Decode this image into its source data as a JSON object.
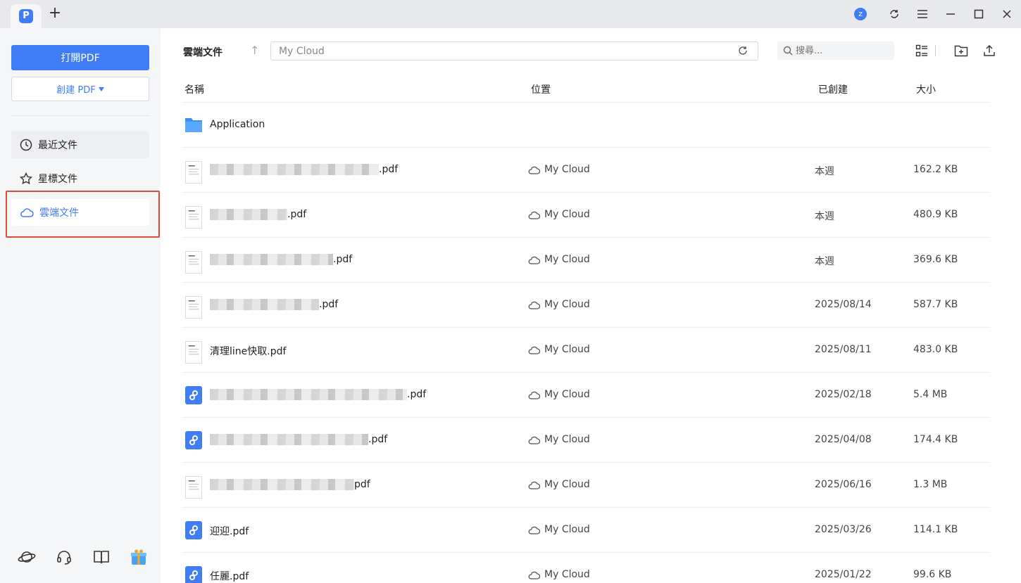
{
  "titlebar": {
    "app_logo_letter": "P",
    "new_tab_symbol": "+",
    "avatar_letter": "z"
  },
  "sidebar": {
    "open_pdf_label": "打開PDF",
    "create_pdf_label": "創建 PDF",
    "nav": [
      {
        "label": "最近文件",
        "icon": "clock-icon"
      },
      {
        "label": "星標文件",
        "icon": "star-icon"
      },
      {
        "label": "雲端文件",
        "icon": "cloud-icon"
      }
    ]
  },
  "toolbar": {
    "title": "雲端文件",
    "path_value": "My Cloud",
    "search_placeholder": "搜尋..."
  },
  "table": {
    "headers": {
      "name": "名稱",
      "location": "位置",
      "created": "已創建",
      "size": "大小"
    },
    "rows": [
      {
        "name_visible": "Application",
        "type": "folder",
        "location": "",
        "created": "",
        "size": ""
      },
      {
        "name_visible": ".pdf",
        "type": "doc",
        "location": "My Cloud",
        "created": "本週",
        "size": "162.2 KB"
      },
      {
        "name_visible": ".pdf",
        "type": "doc",
        "location": "My Cloud",
        "created": "本週",
        "size": "480.9 KB"
      },
      {
        "name_visible": ".pdf",
        "type": "doc",
        "location": "My Cloud",
        "created": "本週",
        "size": "369.6 KB"
      },
      {
        "name_visible": ".pdf",
        "type": "doc",
        "location": "My Cloud",
        "created": "2025/08/14",
        "size": "587.7 KB"
      },
      {
        "name_visible": "清理line快取.pdf",
        "type": "doc",
        "location": "My Cloud",
        "created": "2025/08/11",
        "size": "483.0 KB"
      },
      {
        "name_visible": ".pdf",
        "type": "pdfapp",
        "location": "My Cloud",
        "created": "2025/02/18",
        "size": "5.4 MB"
      },
      {
        "name_visible": ".pdf",
        "type": "pdfapp",
        "location": "My Cloud",
        "created": "2025/04/08",
        "size": "174.4 KB"
      },
      {
        "name_visible": "pdf",
        "type": "doc",
        "location": "My Cloud",
        "created": "2025/06/16",
        "size": "1.3 MB"
      },
      {
        "name_visible": "迎迎.pdf",
        "type": "pdfapp",
        "location": "My Cloud",
        "created": "2025/03/26",
        "size": "114.1 KB"
      },
      {
        "name_visible": "任麗.pdf",
        "type": "pdfapp",
        "location": "My Cloud",
        "created": "2025/01/22",
        "size": "99.6 KB"
      }
    ]
  },
  "colors": {
    "accent": "#3e7df6",
    "highlight": "#e0483a",
    "sidebar_bg": "#f5f6f8",
    "titlebar_bg": "#e8e9ec"
  }
}
